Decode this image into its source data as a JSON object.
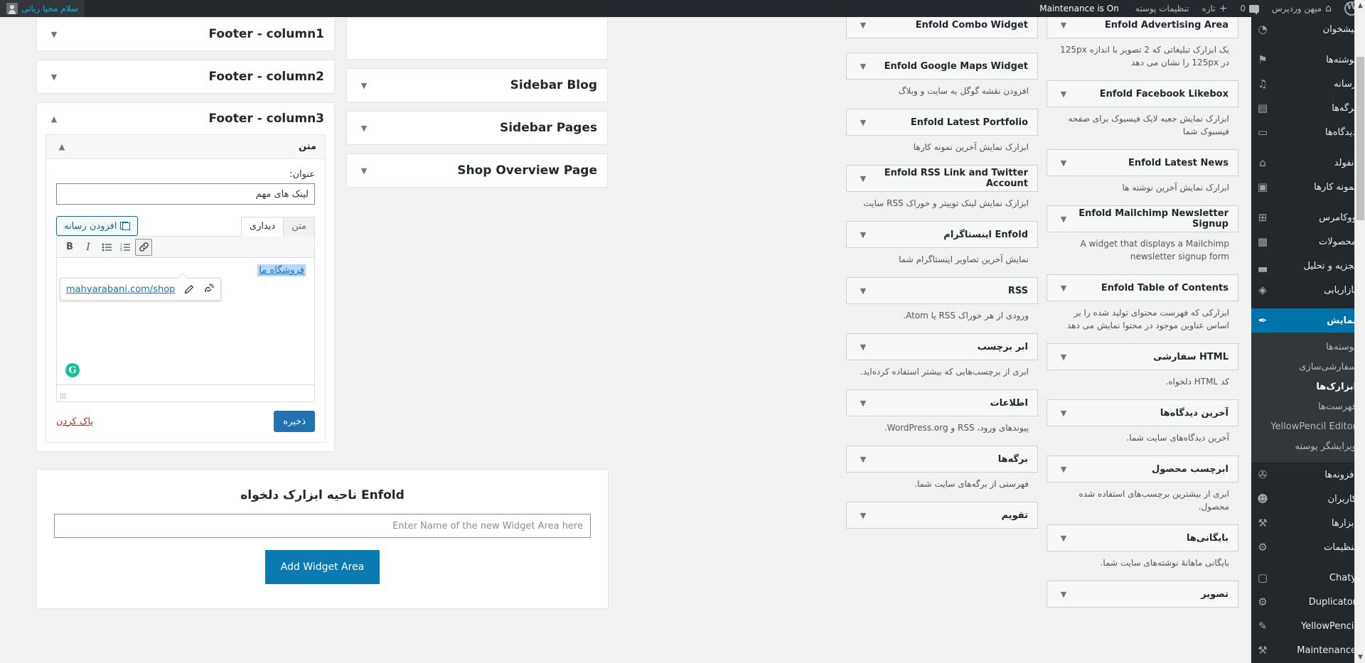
{
  "adminbar": {
    "wp_logo": "wordpress-logo",
    "site_name": "میهن وردپرس",
    "comments_count": "0",
    "new_label": "تازه",
    "theme_settings": "تنظیمات پوسته",
    "maintenance": "Maintenance is On",
    "greeting": "سلام محیا ربانی"
  },
  "sidebar": {
    "items": [
      {
        "label": "پیشخوان",
        "icon": "dashboard-icon",
        "current": false
      },
      {
        "label": "نوشته‌ها",
        "icon": "pin-icon",
        "current": false
      },
      {
        "label": "رسانه",
        "icon": "media-icon",
        "current": false
      },
      {
        "label": "برگه‌ها",
        "icon": "pages-icon",
        "current": false
      },
      {
        "label": "دیدگاه‌ها",
        "icon": "comment-icon",
        "current": false
      },
      {
        "label": "انفولد",
        "icon": "home-icon",
        "current": false
      },
      {
        "label": "نمونه کارها",
        "icon": "portfolio-icon",
        "current": false
      },
      {
        "label": "ووکامرس",
        "icon": "woo-icon",
        "current": false
      },
      {
        "label": "محصولات",
        "icon": "products-icon",
        "current": false
      },
      {
        "label": "تجزیه و تحلیل",
        "icon": "chart-icon",
        "current": false
      },
      {
        "label": "بازاریابی",
        "icon": "megaphone-icon",
        "current": false
      },
      {
        "label": "نمایش",
        "icon": "appearance-brush-icon",
        "current": true
      }
    ],
    "submenu": [
      {
        "label": "پوسته‌ها",
        "current": false
      },
      {
        "label": "سفارشی‌سازی",
        "current": false
      },
      {
        "label": "ابزارک‌ها",
        "current": true
      },
      {
        "label": "فهرست‌ها",
        "current": false
      },
      {
        "label": "YellowPencil Editor",
        "current": false
      },
      {
        "label": "ویرایشگر پوسته",
        "current": false
      }
    ],
    "items_after": [
      {
        "label": "افزونه‌ها",
        "icon": "plugin-icon",
        "current": false
      },
      {
        "label": "کاربران",
        "icon": "users-icon",
        "current": false
      },
      {
        "label": "ابزارها",
        "icon": "tools-icon",
        "current": false
      },
      {
        "label": "تنظیمات",
        "icon": "settings-icon",
        "current": false
      },
      {
        "label": "Chaty",
        "icon": "chat-icon",
        "current": false
      },
      {
        "label": "Duplicator",
        "icon": "duplicator-icon",
        "current": false
      },
      {
        "label": "YellowPencil",
        "icon": "pencil-icon",
        "current": false
      },
      {
        "label": "Maintenance",
        "icon": "maintenance-icon",
        "current": false
      }
    ]
  },
  "left_column": {
    "footer_areas": [
      {
        "title": "Footer - column1",
        "expanded": false
      },
      {
        "title": "Footer - column2",
        "expanded": false
      },
      {
        "title": "Footer - column3",
        "expanded": true
      }
    ],
    "text_widget": {
      "title": "متن",
      "title_field_label": "عنوان:",
      "title_field_value": "لینک های مهم",
      "add_media_label": "افزودن رسانه",
      "tab_visual": "دیداری",
      "tab_text": "متن",
      "toolbar": [
        "link-icon",
        "ordered-list-icon",
        "unordered-list-icon",
        "italic-icon",
        "bold-icon"
      ],
      "content_link_text": "فروشگاه ما",
      "link_popup_url": "mahyarabani.com/shop",
      "link_popup_edit_icon": "pencil-icon",
      "link_popup_unlink_icon": "unlink-icon",
      "grammarly_badge": "G",
      "save_label": "ذخیره",
      "delete_label": "پاک کردن"
    }
  },
  "enfold_panel": {
    "title": "Enfold ناحیه ابزارک دلخواه",
    "input_placeholder": "Enter Name of the new Widget Area here",
    "input_value": "",
    "button_label": "Add Widget Area"
  },
  "middle_column": {
    "areas": [
      {
        "title": "",
        "expanded": false,
        "blank": true
      },
      {
        "title": "Sidebar Blog",
        "expanded": false
      },
      {
        "title": "Sidebar Pages",
        "expanded": false
      },
      {
        "title": "Shop Overview Page",
        "expanded": false
      }
    ]
  },
  "available_widgets": {
    "col_right": [
      {
        "title": "Enfold Advertising Area",
        "desc": "یک ابزارک تبلیغاتی که 2 تصویر با اندازه 125px در 125px را نشان می دهد"
      },
      {
        "title": "Enfold Facebook Likebox",
        "desc": "ابزارک نمایش جعبه لایک فیسبوک برای صفحه فیسبوک شما"
      },
      {
        "title": "Enfold Latest News",
        "desc": "ابزارک نمایش آخرین نوشته ها"
      },
      {
        "title": "Enfold Mailchimp Newsletter Signup",
        "desc": "A widget that displays a Mailchimp newsletter signup form"
      },
      {
        "title": "Enfold Table of Contents",
        "desc": "ابزارکی که فهرست محتوای تولید شده را بر اساس عناوین موجود در محتوا نمایش می دهد"
      },
      {
        "title": "HTML سفارشی",
        "desc": "کد HTML دلخواه."
      },
      {
        "title": "آخرین دیدگاه‌ها",
        "desc": "آخرین دیدگاه‌های سایت شما."
      },
      {
        "title": "ابرچسب محصول",
        "desc": "ابری از بیشترین برچسب‌های استفاده شده محصول."
      },
      {
        "title": "بایگانی‌ها",
        "desc": "بایگانی ماهانهٔ نوشته‌های سایت شما."
      },
      {
        "title": "تصویر",
        "desc": ""
      }
    ],
    "col_left": [
      {
        "title": "Enfold Combo Widget",
        "desc": ""
      },
      {
        "title": "Enfold Google Maps Widget",
        "desc": "افزودن نقشه گوگل به سایت و وبلاگ"
      },
      {
        "title": "Enfold Latest Portfolio",
        "desc": "ابزارک نمایش آخرین نمونه کارها"
      },
      {
        "title": "Enfold RSS Link and Twitter Account",
        "desc": "ابزارک نمایش لینک توییتر و خوراک RSS سایت"
      },
      {
        "title": "Enfold اینستاگرام",
        "desc": "نمایش آخرین تصاویر اینستاگرام شما"
      },
      {
        "title": "RSS",
        "desc": "ورودی از هر خوراک RSS یا Atom."
      },
      {
        "title": "ابر برچسب",
        "desc": "ابری از برچسب‌هایی که بیشتر استفاده کرده‌اید."
      },
      {
        "title": "اطلاعات",
        "desc": "پیوندهای ورود، RSS و WordPress.org."
      },
      {
        "title": "برگه‌ها",
        "desc": "فهرستی از برگه‌های سایت شما."
      },
      {
        "title": "تقویم",
        "desc": ""
      }
    ]
  },
  "colors": {
    "admin_bar": "#23282d",
    "accent": "#0073aa",
    "primary_button": "#2271b1",
    "add_widget_button": "#0a7ab0",
    "link_blue": "#2271b1",
    "delete_red": "#b32d2e",
    "grammarly_green": "#15c39a"
  }
}
